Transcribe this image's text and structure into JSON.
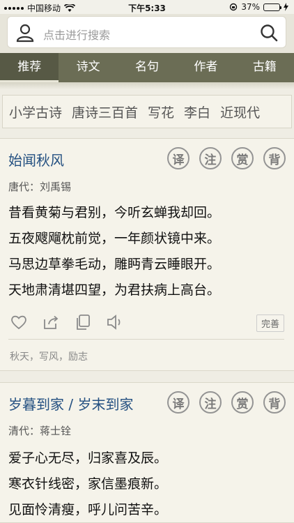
{
  "status_bar": {
    "carrier": "中国移动",
    "time": "下午5:33",
    "battery_percent": "37%",
    "battery_level": 0.37
  },
  "search": {
    "placeholder": "点击进行搜索"
  },
  "tabs": [
    {
      "label": "推荐",
      "active": true
    },
    {
      "label": "诗文",
      "active": false
    },
    {
      "label": "名句",
      "active": false
    },
    {
      "label": "作者",
      "active": false
    },
    {
      "label": "古籍",
      "active": false
    }
  ],
  "tags": [
    "小学古诗",
    "唐诗三百首",
    "写花",
    "李白",
    "近现代"
  ],
  "action_labels": [
    "译",
    "注",
    "赏",
    "背"
  ],
  "poems": [
    {
      "title": "始闻秋风",
      "meta": "唐代：刘禹锡",
      "lines": [
        "昔看黄菊与君别，今听玄蝉我却回。",
        "五夜飕飗枕前觉，一年颜状镜中来。",
        "马思边草拳毛动，雕眄青云睡眼开。",
        "天地肃清堪四望，为君扶病上高台。"
      ],
      "perfect_label": "完善",
      "tags_text": "秋天，写风，励志"
    },
    {
      "title": "岁暮到家 / 岁末到家",
      "meta": "清代：蒋士铨",
      "lines": [
        "爱子心无尽，归家喜及辰。",
        "寒衣针线密，家信墨痕新。",
        "见面怜清瘦，呼儿问苦辛。"
      ]
    }
  ],
  "colors": {
    "title_blue": "#245081",
    "tab_bar": "#6b6d55",
    "background": "#efede4"
  }
}
